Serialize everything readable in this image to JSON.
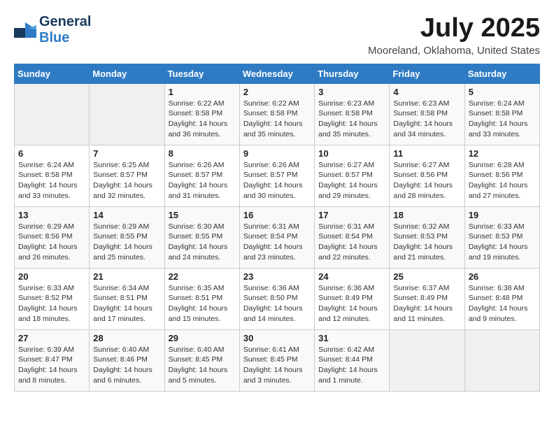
{
  "header": {
    "logo_general": "General",
    "logo_blue": "Blue",
    "month_title": "July 2025",
    "location": "Mooreland, Oklahoma, United States"
  },
  "days_of_week": [
    "Sunday",
    "Monday",
    "Tuesday",
    "Wednesday",
    "Thursday",
    "Friday",
    "Saturday"
  ],
  "weeks": [
    [
      {
        "day": "",
        "info": ""
      },
      {
        "day": "",
        "info": ""
      },
      {
        "day": "1",
        "info": "Sunrise: 6:22 AM\nSunset: 8:58 PM\nDaylight: 14 hours and 36 minutes."
      },
      {
        "day": "2",
        "info": "Sunrise: 6:22 AM\nSunset: 8:58 PM\nDaylight: 14 hours and 35 minutes."
      },
      {
        "day": "3",
        "info": "Sunrise: 6:23 AM\nSunset: 8:58 PM\nDaylight: 14 hours and 35 minutes."
      },
      {
        "day": "4",
        "info": "Sunrise: 6:23 AM\nSunset: 8:58 PM\nDaylight: 14 hours and 34 minutes."
      },
      {
        "day": "5",
        "info": "Sunrise: 6:24 AM\nSunset: 8:58 PM\nDaylight: 14 hours and 33 minutes."
      }
    ],
    [
      {
        "day": "6",
        "info": "Sunrise: 6:24 AM\nSunset: 8:58 PM\nDaylight: 14 hours and 33 minutes."
      },
      {
        "day": "7",
        "info": "Sunrise: 6:25 AM\nSunset: 8:57 PM\nDaylight: 14 hours and 32 minutes."
      },
      {
        "day": "8",
        "info": "Sunrise: 6:26 AM\nSunset: 8:57 PM\nDaylight: 14 hours and 31 minutes."
      },
      {
        "day": "9",
        "info": "Sunrise: 6:26 AM\nSunset: 8:57 PM\nDaylight: 14 hours and 30 minutes."
      },
      {
        "day": "10",
        "info": "Sunrise: 6:27 AM\nSunset: 8:57 PM\nDaylight: 14 hours and 29 minutes."
      },
      {
        "day": "11",
        "info": "Sunrise: 6:27 AM\nSunset: 8:56 PM\nDaylight: 14 hours and 28 minutes."
      },
      {
        "day": "12",
        "info": "Sunrise: 6:28 AM\nSunset: 8:56 PM\nDaylight: 14 hours and 27 minutes."
      }
    ],
    [
      {
        "day": "13",
        "info": "Sunrise: 6:29 AM\nSunset: 8:56 PM\nDaylight: 14 hours and 26 minutes."
      },
      {
        "day": "14",
        "info": "Sunrise: 6:29 AM\nSunset: 8:55 PM\nDaylight: 14 hours and 25 minutes."
      },
      {
        "day": "15",
        "info": "Sunrise: 6:30 AM\nSunset: 8:55 PM\nDaylight: 14 hours and 24 minutes."
      },
      {
        "day": "16",
        "info": "Sunrise: 6:31 AM\nSunset: 8:54 PM\nDaylight: 14 hours and 23 minutes."
      },
      {
        "day": "17",
        "info": "Sunrise: 6:31 AM\nSunset: 8:54 PM\nDaylight: 14 hours and 22 minutes."
      },
      {
        "day": "18",
        "info": "Sunrise: 6:32 AM\nSunset: 8:53 PM\nDaylight: 14 hours and 21 minutes."
      },
      {
        "day": "19",
        "info": "Sunrise: 6:33 AM\nSunset: 8:53 PM\nDaylight: 14 hours and 19 minutes."
      }
    ],
    [
      {
        "day": "20",
        "info": "Sunrise: 6:33 AM\nSunset: 8:52 PM\nDaylight: 14 hours and 18 minutes."
      },
      {
        "day": "21",
        "info": "Sunrise: 6:34 AM\nSunset: 8:51 PM\nDaylight: 14 hours and 17 minutes."
      },
      {
        "day": "22",
        "info": "Sunrise: 6:35 AM\nSunset: 8:51 PM\nDaylight: 14 hours and 15 minutes."
      },
      {
        "day": "23",
        "info": "Sunrise: 6:36 AM\nSunset: 8:50 PM\nDaylight: 14 hours and 14 minutes."
      },
      {
        "day": "24",
        "info": "Sunrise: 6:36 AM\nSunset: 8:49 PM\nDaylight: 14 hours and 12 minutes."
      },
      {
        "day": "25",
        "info": "Sunrise: 6:37 AM\nSunset: 8:49 PM\nDaylight: 14 hours and 11 minutes."
      },
      {
        "day": "26",
        "info": "Sunrise: 6:38 AM\nSunset: 8:48 PM\nDaylight: 14 hours and 9 minutes."
      }
    ],
    [
      {
        "day": "27",
        "info": "Sunrise: 6:39 AM\nSunset: 8:47 PM\nDaylight: 14 hours and 8 minutes."
      },
      {
        "day": "28",
        "info": "Sunrise: 6:40 AM\nSunset: 8:46 PM\nDaylight: 14 hours and 6 minutes."
      },
      {
        "day": "29",
        "info": "Sunrise: 6:40 AM\nSunset: 8:45 PM\nDaylight: 14 hours and 5 minutes."
      },
      {
        "day": "30",
        "info": "Sunrise: 6:41 AM\nSunset: 8:45 PM\nDaylight: 14 hours and 3 minutes."
      },
      {
        "day": "31",
        "info": "Sunrise: 6:42 AM\nSunset: 8:44 PM\nDaylight: 14 hours and 1 minute."
      },
      {
        "day": "",
        "info": ""
      },
      {
        "day": "",
        "info": ""
      }
    ]
  ]
}
